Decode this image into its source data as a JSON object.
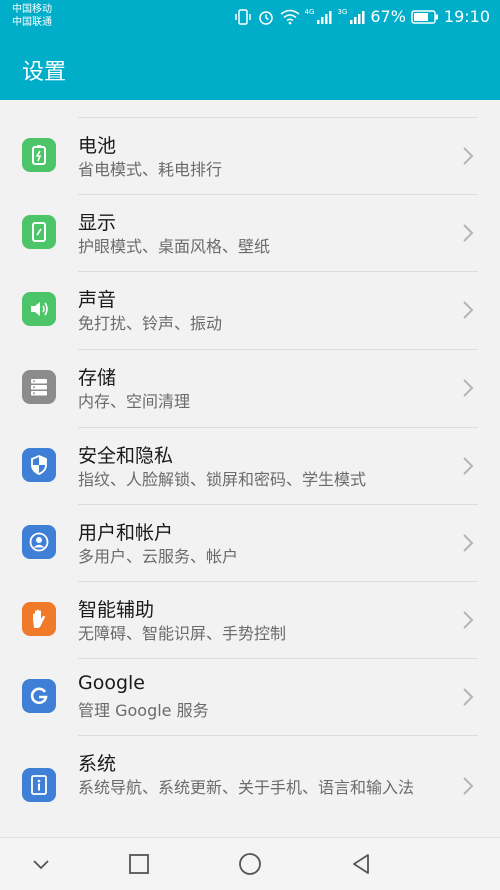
{
  "status_bar": {
    "carrier_1": "中国移动",
    "carrier_2": "中国联通",
    "signal_1_label": "4G",
    "signal_2_label": "3G",
    "battery_percent": "67%",
    "time": "19:10",
    "icons": [
      "vibrate-icon",
      "alarm-icon",
      "wifi-icon",
      "signal-icon",
      "battery-icon"
    ]
  },
  "app_bar": {
    "title": "设置"
  },
  "settings": [
    {
      "title": "电池",
      "subtitle": "省电模式、耗电排行",
      "icon": "battery-icon",
      "color": "#4cc46a"
    },
    {
      "title": "显示",
      "subtitle": "护眼模式、桌面风格、壁纸",
      "icon": "display-icon",
      "color": "#4cc46a"
    },
    {
      "title": "声音",
      "subtitle": "免打扰、铃声、振动",
      "icon": "speaker-icon",
      "color": "#4cc46a"
    },
    {
      "title": "存储",
      "subtitle": "内存、空间清理",
      "icon": "storage-icon",
      "color": "#8c8c8c"
    },
    {
      "title": "安全和隐私",
      "subtitle": "指纹、人脸解锁、锁屏和密码、学生模式",
      "icon": "shield-icon",
      "color": "#3f7fd6"
    },
    {
      "title": "用户和帐户",
      "subtitle": "多用户、云服务、帐户",
      "icon": "user-icon",
      "color": "#3f7fd6"
    },
    {
      "title": "智能辅助",
      "subtitle": "无障碍、智能识屏、手势控制",
      "icon": "hand-icon",
      "color": "#f07a2a"
    },
    {
      "title": "Google",
      "subtitle": "管理 Google 服务",
      "icon": "google-icon",
      "color": "#3f7fd6"
    },
    {
      "title": "系统",
      "subtitle": "系统导航、系统更新、关于手机、语言和输入法",
      "icon": "system-info-icon",
      "color": "#3f7fd6"
    }
  ],
  "nav_bar": {
    "icons": [
      "collapse-icon",
      "recents-icon",
      "home-icon",
      "back-icon"
    ]
  }
}
